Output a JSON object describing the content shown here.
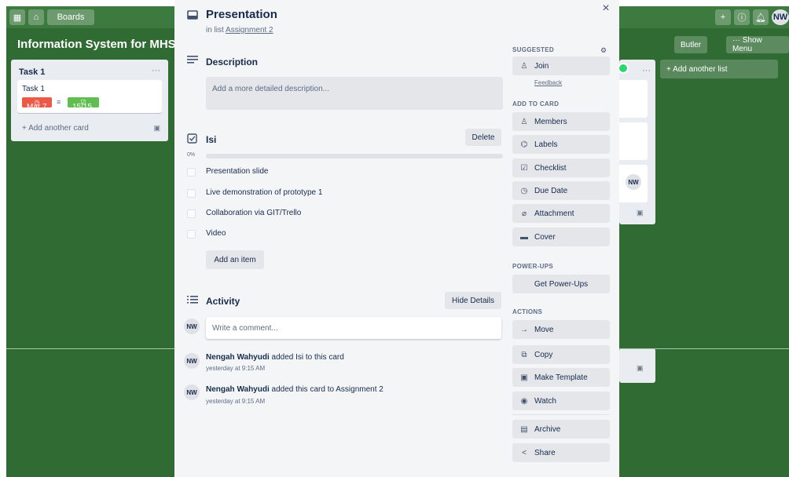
{
  "board": {
    "nav_boards": "Boards",
    "title": "Information System for MHS",
    "butler": "Butler",
    "show_menu": "··· Show Menu",
    "avatar_initials": "NW",
    "list1": {
      "title": "Task 1",
      "card_title": "Task 1",
      "due_badge": "Mar 7",
      "checklist_badge": "15/15",
      "add_card": "+ Add another card"
    },
    "list_avatar": "NW",
    "add_list": "+ Add another list"
  },
  "modal": {
    "title": "Presentation",
    "in_list_prefix": "in list",
    "in_list_link": "Assignment 2",
    "description": {
      "heading": "Description",
      "placeholder": "Add a more detailed description..."
    },
    "checklist": {
      "heading": "Isi",
      "delete_label": "Delete",
      "progress_label": "0%",
      "progress_value": 0,
      "items": [
        "Presentation slide",
        "Live demonstration of prototype 1",
        "Collaboration via GIT/Trello",
        "Video"
      ],
      "add_item_label": "Add an item"
    },
    "activity": {
      "heading": "Activity",
      "hide_details_label": "Hide Details",
      "comment_avatar": "NW",
      "comment_placeholder": "Write a comment...",
      "entries": [
        {
          "avatar": "NW",
          "user": "Nengah Wahyudi",
          "text": "added Isi to this card",
          "time": "yesterday at 9:15 AM"
        },
        {
          "avatar": "NW",
          "user": "Nengah Wahyudi",
          "text": "added this card to Assignment 2",
          "time": "yesterday at 9:15 AM"
        }
      ]
    },
    "close_icon": "×",
    "sidebar": {
      "suggested": "SUGGESTED",
      "join": "Join",
      "feedback": "Feedback",
      "add_to_card": "ADD TO CARD",
      "members": "Members",
      "labels": "Labels",
      "checklist": "Checklist",
      "due_date": "Due Date",
      "attachment": "Attachment",
      "cover": "Cover",
      "power_ups": "POWER-UPS",
      "get_power_ups": "Get Power-Ups",
      "actions": "ACTIONS",
      "move": "Move",
      "copy": "Copy",
      "make_template": "Make Template",
      "watch": "Watch",
      "archive": "Archive",
      "share": "Share"
    }
  }
}
